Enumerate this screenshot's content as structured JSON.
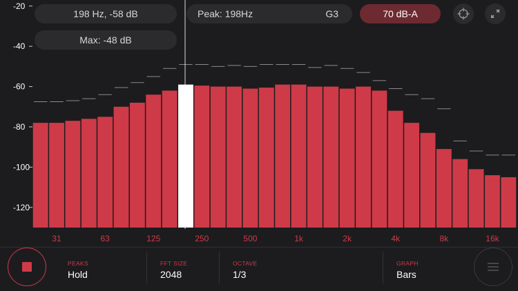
{
  "header": {
    "cursor_readout": "198 Hz, -58 dB",
    "max_readout": "Max: -48 dB",
    "peak_label": "Peak: 198Hz",
    "peak_note": "G3",
    "level_label": "70 dB-A"
  },
  "icons": {
    "crosshair": "crosshair-icon",
    "expand": "expand-arrows-icon",
    "record": "stop-square-icon",
    "menu": "hamburger-menu-icon"
  },
  "controls": {
    "peaks": {
      "label": "PEAKS",
      "value": "Hold"
    },
    "fft_size": {
      "label": "FFT SIZE",
      "value": "2048"
    },
    "octave": {
      "label": "OCTAVE",
      "value": "1/3"
    },
    "graph": {
      "label": "GRAPH",
      "value": "Bars"
    }
  },
  "colors": {
    "bar": "#cf3a48",
    "highlight_bar": "#ffffff",
    "peak_marker": "#8a8a8e",
    "background": "#1c1c1e",
    "accent": "#cf3a48"
  },
  "chart_data": {
    "type": "bar",
    "y_ticks": [
      "-20",
      "-40",
      "-60",
      "-80",
      "-100",
      "-120"
    ],
    "y_tick_values": [
      -20,
      -40,
      -60,
      -80,
      -100,
      -120
    ],
    "ylim": [
      -130,
      -17
    ],
    "x_tick_labels": [
      "31",
      "63",
      "125",
      "250",
      "500",
      "1k",
      "2k",
      "4k",
      "8k",
      "16k"
    ],
    "x_tick_bar_index": [
      1,
      4,
      7,
      10,
      13,
      16,
      19,
      22,
      25,
      28
    ],
    "selected_bar_index": 9,
    "values": [
      -78,
      -78,
      -77,
      -76,
      -75,
      -70,
      -68,
      -64,
      -62,
      -59,
      -59.5,
      -60,
      -60,
      -61,
      -60.5,
      -59,
      -59,
      -60,
      -60,
      -61,
      -60,
      -62,
      -72,
      -78,
      -83,
      -91,
      -96,
      -101,
      -104,
      -105
    ],
    "peaks": [
      -67.5,
      -67.5,
      -67,
      -66,
      -64,
      -60.5,
      -58,
      -55,
      -51,
      -49,
      -49,
      -50,
      -49.5,
      -50,
      -49,
      -49,
      -49,
      -50.5,
      -49.5,
      -51,
      -53,
      -57,
      -61,
      -64,
      -66,
      -71,
      -87,
      -92,
      -94,
      -94
    ]
  }
}
